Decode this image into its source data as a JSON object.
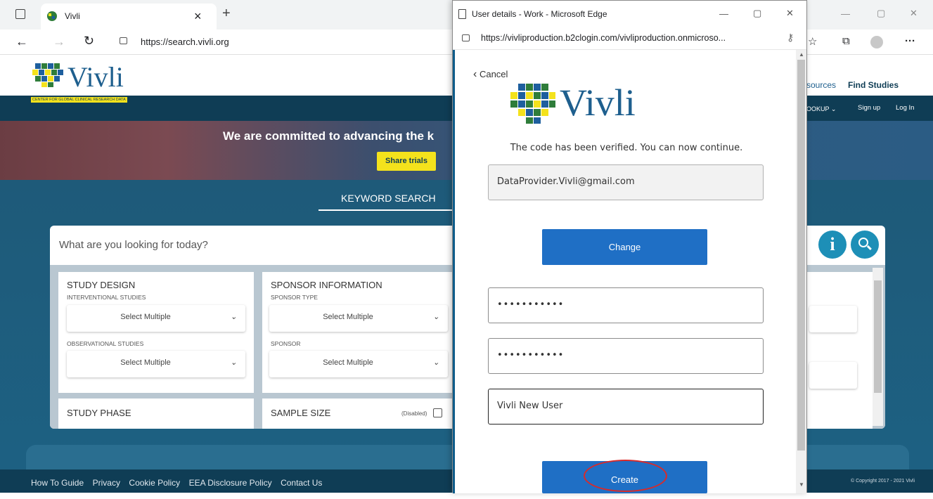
{
  "browser": {
    "tab_title": "Vivli",
    "tab_close": "×",
    "new_tab": "+",
    "address": "https://search.vivli.org",
    "window_controls": {
      "minimize": "—",
      "maximize": "▢",
      "close": "✕"
    },
    "toolbar_more": "···"
  },
  "site": {
    "logo_text": "Vivli",
    "logo_tagline": "CENTER FOR GLOBAL CLINICAL RESEARCH DATA",
    "nav_top": {
      "resources": "sources",
      "find_studies": "Find Studies"
    },
    "nav_bottom": {
      "lookup": "OOKUP ⌄",
      "sign_up": "Sign up",
      "log_in": "Log In"
    },
    "hero_text": "We are committed to advancing the k",
    "share_button": "Share trials",
    "keyword_tab": "KEYWORD SEARCH",
    "search_placeholder": "What are you looking for today?",
    "filters": {
      "study_design": {
        "title": "STUDY DESIGN",
        "interventional_label": "INTERVENTIONAL STUDIES",
        "interventional_value": "Select Multiple",
        "observational_label": "OBSERVATIONAL STUDIES",
        "observational_value": "Select Multiple"
      },
      "sponsor": {
        "title": "SPONSOR INFORMATION",
        "type_label": "SPONSOR TYPE",
        "type_value": "Select Multiple",
        "sponsor_label": "SPONSOR",
        "sponsor_value": "Select Multiple"
      },
      "study_phase": {
        "title": "STUDY PHASE"
      },
      "sample_size": {
        "title": "SAMPLE SIZE",
        "disabled_label": "(Disabled)"
      }
    },
    "footer_links": [
      "How To Guide",
      "Privacy",
      "Cookie Policy",
      "EEA Disclosure Policy",
      "Contact Us"
    ],
    "copyright": "© Copyright 2017 - 2021 Vivli"
  },
  "popup": {
    "window_title": "User details - Work - Microsoft Edge",
    "url": "https://vivliproduction.b2clogin.com/vivliproduction.onmicroso...",
    "cancel_label": "Cancel",
    "logo_text": "Vivli",
    "verified_message": "The code has been verified. You can now continue.",
    "email_value": "DataProvider.Vivli@gmail.com",
    "change_button": "Change",
    "password_value": "•••••••••••",
    "confirm_password_value": "•••••••••••",
    "display_name_value": "Vivli New User",
    "create_button": "Create"
  },
  "colors": {
    "site_primary": "#0f3d55",
    "hero_button": "#f4e21c",
    "popup_button": "#1f6fc5",
    "highlight_ring": "#d82a2a"
  }
}
